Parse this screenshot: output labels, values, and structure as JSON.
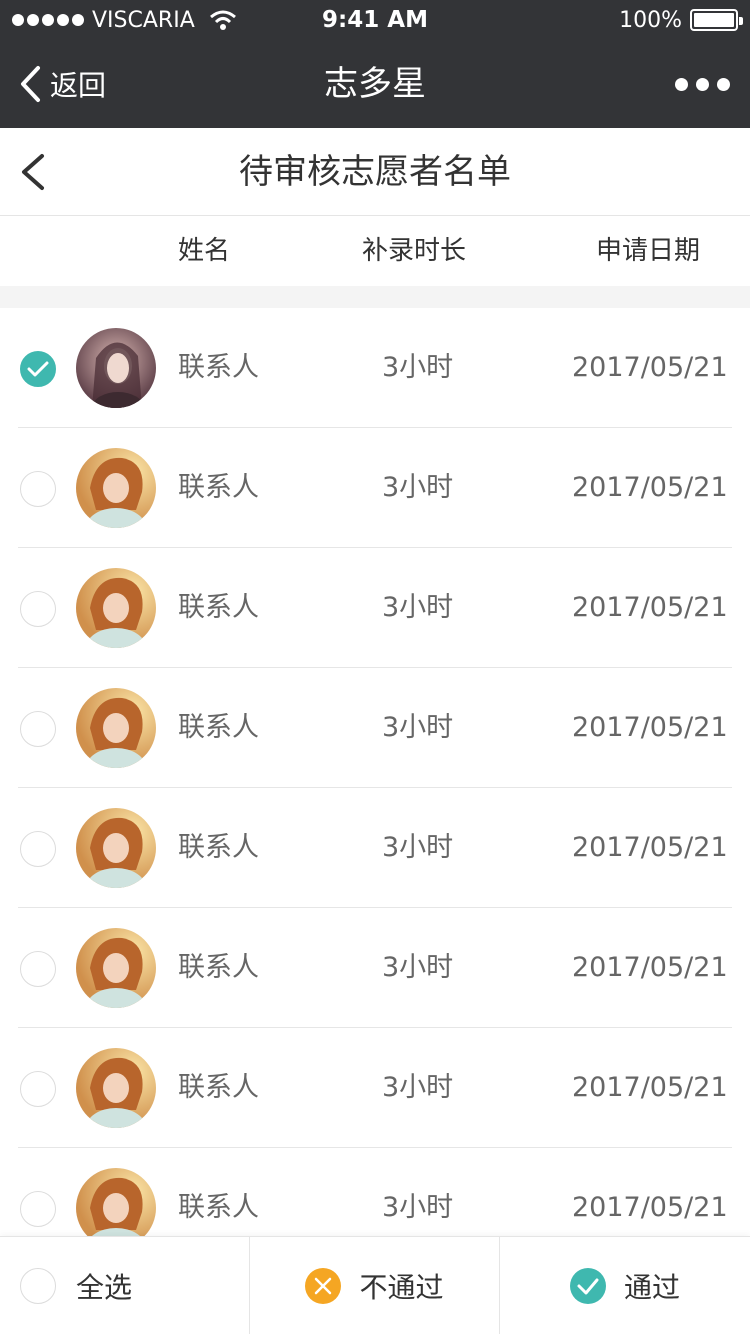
{
  "status_bar": {
    "carrier": "VISCARIA",
    "time": "9:41 AM",
    "battery": "100%"
  },
  "nav": {
    "back_label": "返回",
    "title": "志多星"
  },
  "page": {
    "title": "待审核志愿者名单"
  },
  "columns": {
    "name": "姓名",
    "hours": "补录时长",
    "date": "申请日期"
  },
  "rows": [
    {
      "name": "联系人",
      "hours": "3小时",
      "date": "2017/05/21",
      "checked": true
    },
    {
      "name": "联系人",
      "hours": "3小时",
      "date": "2017/05/21",
      "checked": false
    },
    {
      "name": "联系人",
      "hours": "3小时",
      "date": "2017/05/21",
      "checked": false
    },
    {
      "name": "联系人",
      "hours": "3小时",
      "date": "2017/05/21",
      "checked": false
    },
    {
      "name": "联系人",
      "hours": "3小时",
      "date": "2017/05/21",
      "checked": false
    },
    {
      "name": "联系人",
      "hours": "3小时",
      "date": "2017/05/21",
      "checked": false
    },
    {
      "name": "联系人",
      "hours": "3小时",
      "date": "2017/05/21",
      "checked": false
    },
    {
      "name": "联系人",
      "hours": "3小时",
      "date": "2017/05/21",
      "checked": false
    }
  ],
  "bottom": {
    "select_all": "全选",
    "reject": "不通过",
    "approve": "通过"
  },
  "colors": {
    "bar_bg": "#333437",
    "accent_teal": "#3fb8af",
    "reject_orange": "#f5a623"
  },
  "icons": {
    "back": "chevron-left-icon",
    "more": "more-dots-icon",
    "checked": "check-circle-icon",
    "reject": "close-circle-icon",
    "approve": "check-circle-icon"
  }
}
